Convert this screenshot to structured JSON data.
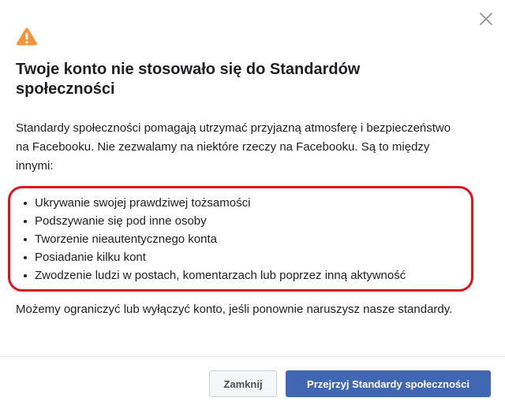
{
  "dialog": {
    "title": "Twoje konto nie stosowało się do Standardów społeczności",
    "intro": "Standardy społeczności pomagają utrzymać przyjazną atmosferę i bezpieczeństwo na Facebooku. Nie zezwalamy na niektóre rzeczy na Facebooku. Są to między innymi:",
    "rules": [
      "Ukrywanie swojej prawdziwej tożsamości",
      "Podszywanie się pod inne osoby",
      "Tworzenie nieautentycznego konta",
      "Posiadanie kilku kont",
      "Zwodzenie ludzi w postach, komentarzach lub poprzez inną aktywność"
    ],
    "outro": "Możemy ograniczyć lub wyłączyć konto, jeśli ponownie naruszysz nasze standardy.",
    "icons": {
      "warning": "warning-icon",
      "close": "close-icon"
    }
  },
  "footer": {
    "close_label": "Zamknij",
    "review_label": "Przejrzyj Standardy społeczności"
  },
  "colors": {
    "warning": "#f7923b",
    "highlight_border": "#e0121b",
    "primary_button": "#4267b2"
  }
}
